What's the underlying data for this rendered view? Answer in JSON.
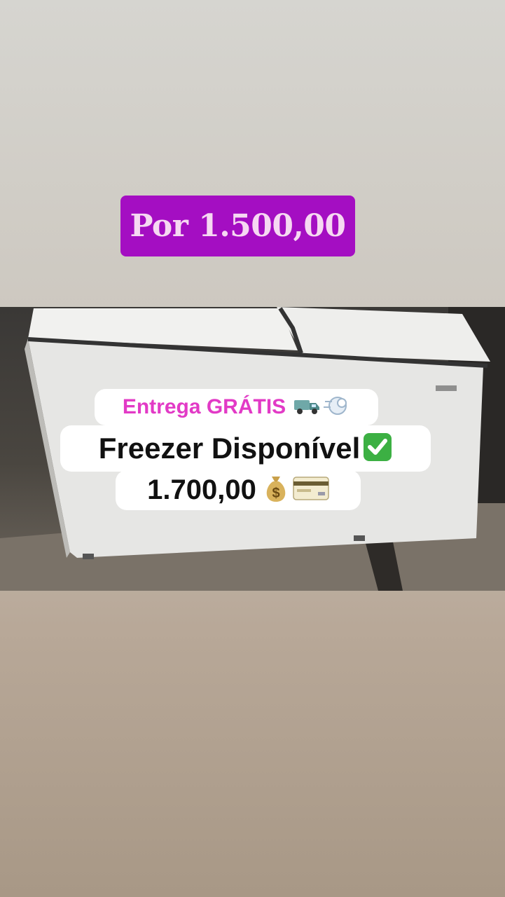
{
  "badge": {
    "price_label": "Por 1.500,00"
  },
  "overlay": {
    "delivery_label": "Entrega GRÁTIS",
    "product_label": "Freezer Disponível",
    "price_label": "1.700,00"
  },
  "icons": [
    "truck-icon",
    "dash-icon",
    "check-mark-icon",
    "money-bag-icon",
    "credit-card-icon"
  ],
  "colors": {
    "badge_bg": "#a40ec2",
    "badge_text": "#f6d8f2",
    "delivery_text": "#e23ac6",
    "check_green": "#3cb043"
  }
}
